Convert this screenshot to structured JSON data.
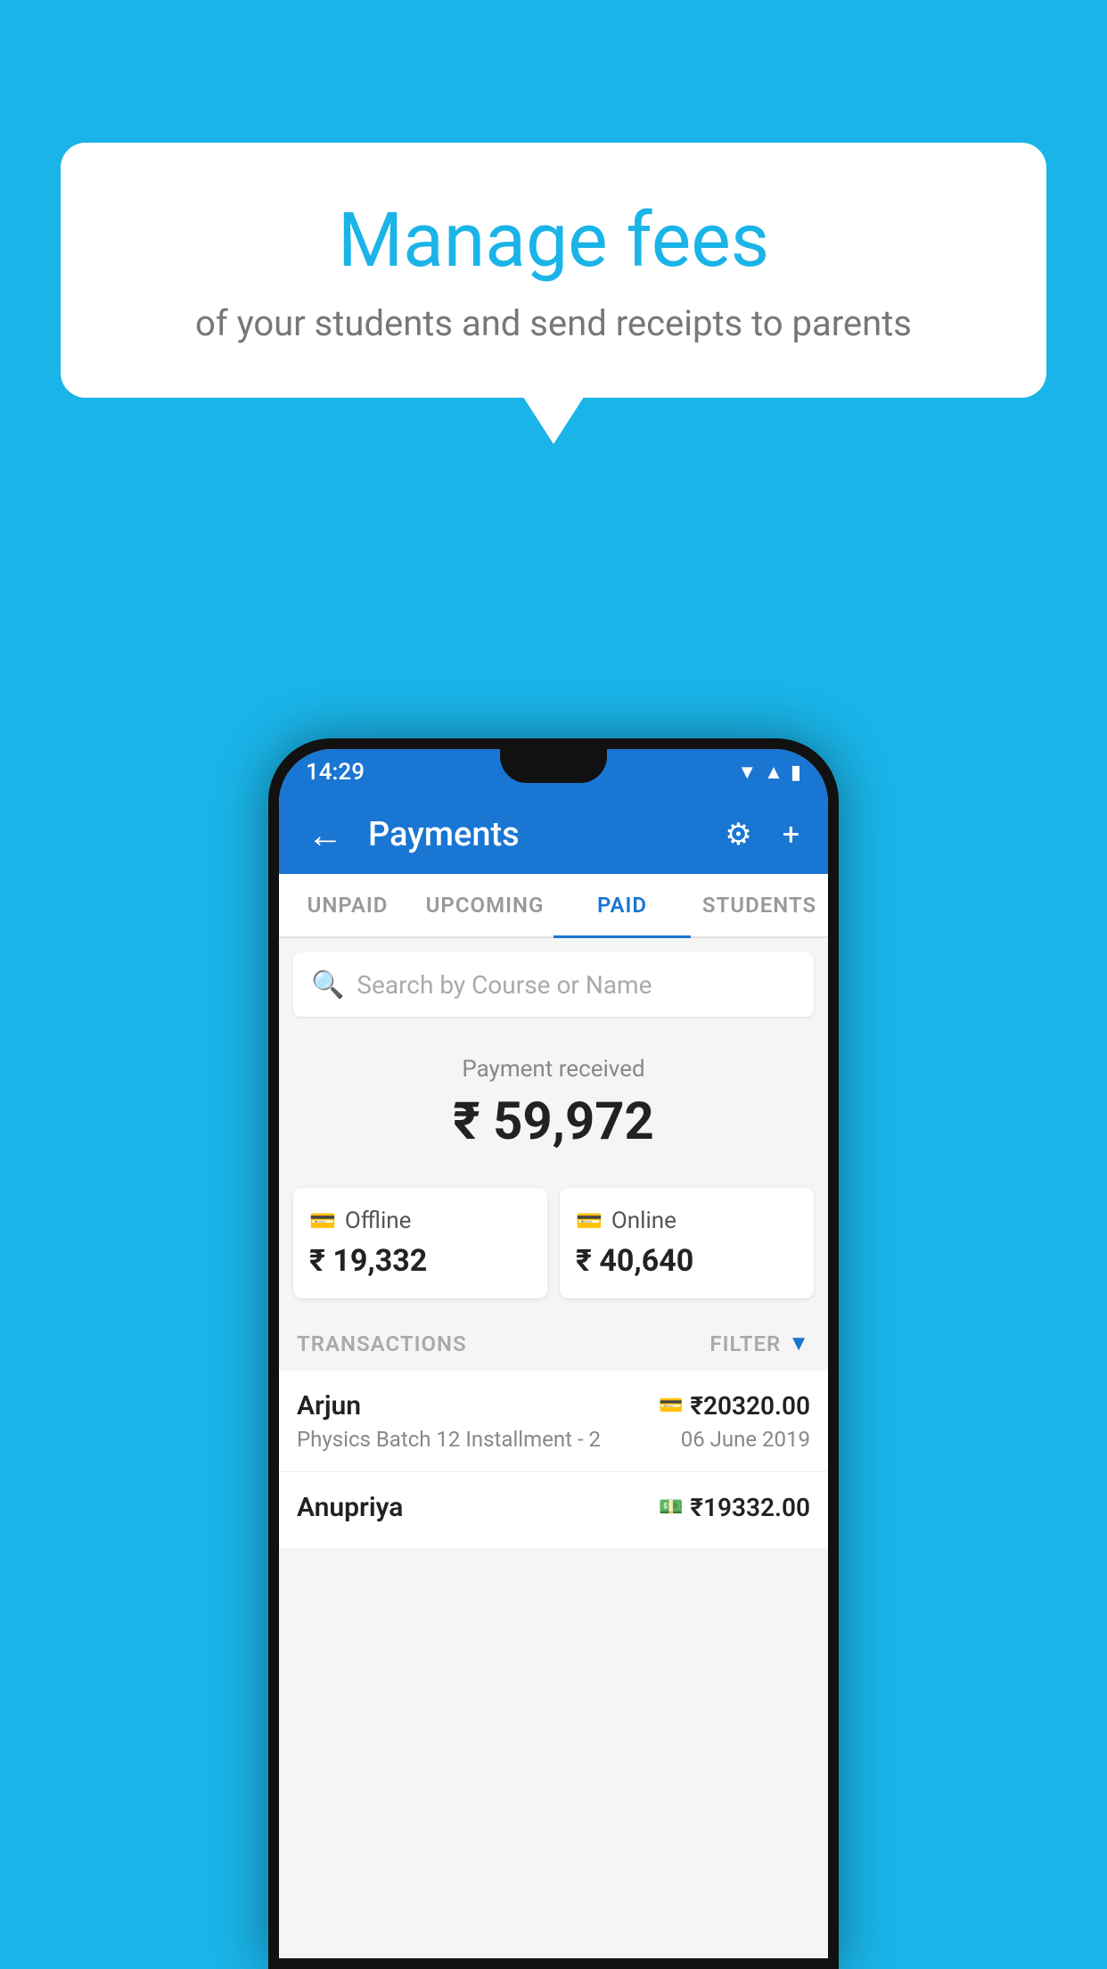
{
  "page": {
    "background_color": "#1ab4e8"
  },
  "bubble": {
    "title": "Manage fees",
    "subtitle": "of your students and send receipts to parents"
  },
  "status_bar": {
    "time": "14:29",
    "wifi_icon": "▲",
    "signal_icon": "▲",
    "battery_icon": "▮"
  },
  "app_bar": {
    "title": "Payments",
    "back_icon": "←",
    "settings_icon": "⚙",
    "add_icon": "+"
  },
  "tabs": [
    {
      "label": "UNPAID",
      "active": false
    },
    {
      "label": "UPCOMING",
      "active": false
    },
    {
      "label": "PAID",
      "active": true
    },
    {
      "label": "STUDENTS",
      "active": false
    }
  ],
  "search": {
    "placeholder": "Search by Course or Name"
  },
  "payment_summary": {
    "label": "Payment received",
    "amount": "₹ 59,972",
    "offline_label": "Offline",
    "offline_amount": "₹ 19,332",
    "online_label": "Online",
    "online_amount": "₹ 40,640"
  },
  "transactions": {
    "header_label": "TRANSACTIONS",
    "filter_label": "FILTER",
    "rows": [
      {
        "name": "Arjun",
        "amount": "₹20320.00",
        "payment_type": "online",
        "course": "Physics Batch 12 Installment - 2",
        "date": "06 June 2019"
      },
      {
        "name": "Anupriya",
        "amount": "₹19332.00",
        "payment_type": "offline",
        "course": "",
        "date": ""
      }
    ]
  }
}
